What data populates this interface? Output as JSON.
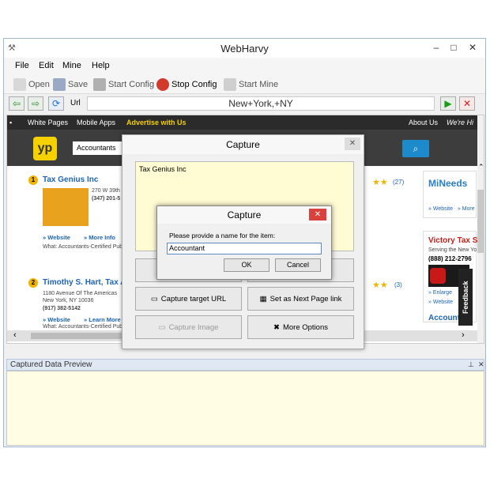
{
  "window": {
    "title": "WebHarvy"
  },
  "menu": {
    "file": "File",
    "edit": "Edit",
    "mine": "Mine",
    "help": "Help"
  },
  "toolbar": {
    "open": "Open",
    "save": "Save",
    "start_config": "Start Config",
    "stop_config": "Stop Config",
    "start_mine": "Start Mine"
  },
  "nav": {
    "url_label": "Url",
    "url_value": "New+York,+NY"
  },
  "yp": {
    "top_links": [
      "White Pages",
      "Mobile Apps",
      "Advertise with Us",
      "About Us",
      "We're Hi"
    ],
    "logo": "yp",
    "search_value": "Accountants",
    "listings": [
      {
        "num": "1",
        "title": "Tax Genius Inc",
        "addr1": "270 W 39th",
        "phone": "(347) 201-5",
        "links": [
          "» Website",
          "» More Info"
        ],
        "what": "What: Accountants-Certified Public",
        "reviews": "(27)"
      },
      {
        "num": "2",
        "title": "Timothy S. Hart, Tax At",
        "addr1": "1180 Avenue Of The Americas",
        "addr2": "New York, NY 10036",
        "phone": "(917) 382-5142",
        "links": [
          "» Website",
          "» Learn More"
        ],
        "what": "What: Accountants-Certified Public",
        "reviews": "(3)"
      }
    ],
    "side": {
      "ad1": "MiNeeds",
      "ad1_links": "» Website   » More",
      "ad2_title": "Victory Tax Sc",
      "ad2_sub": "Serving the New Yo",
      "ad2_phone": "(888) 212-2796",
      "ad2_links": [
        "» Enlarge",
        "» Website"
      ],
      "ad3_title": "Accountin"
    }
  },
  "feedback": "Feedback",
  "preview": {
    "title": "Captured Data Preview"
  },
  "capture_outer": {
    "title": "Capture",
    "text": "Tax Genius Inc",
    "buttons": {
      "capture_url": "Capture target URL",
      "next_page": "Set as Next Page link",
      "capture_image": "Capture Image",
      "more_options": "More Options"
    }
  },
  "capture_inner": {
    "title": "Capture",
    "prompt": "Please provide a name for the item:",
    "value": "Accountant",
    "ok": "OK",
    "cancel": "Cancel"
  }
}
